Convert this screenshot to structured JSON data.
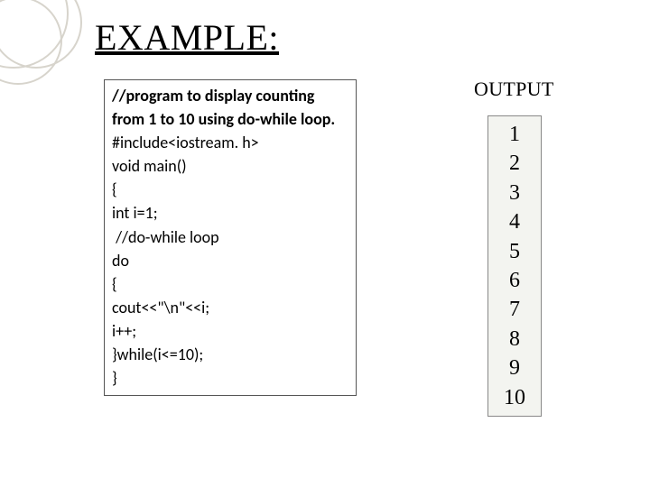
{
  "title": "EXAMPLE:",
  "code": {
    "comment_title_l1": "//program to display counting",
    "comment_title_l2": "from 1 to 10 using do-while loop.",
    "lines": [
      "#include<iostream. h>",
      "void main()",
      "{",
      "int i=1;",
      " //do-while loop",
      "do",
      "{",
      "cout<<\"\\n\"<<i;",
      "i++;",
      "}while(i<=10);",
      "}"
    ]
  },
  "output": {
    "label": "OUTPUT",
    "values": [
      "1",
      "2",
      "3",
      "4",
      "5",
      "6",
      "7",
      "8",
      "9",
      "10"
    ]
  }
}
